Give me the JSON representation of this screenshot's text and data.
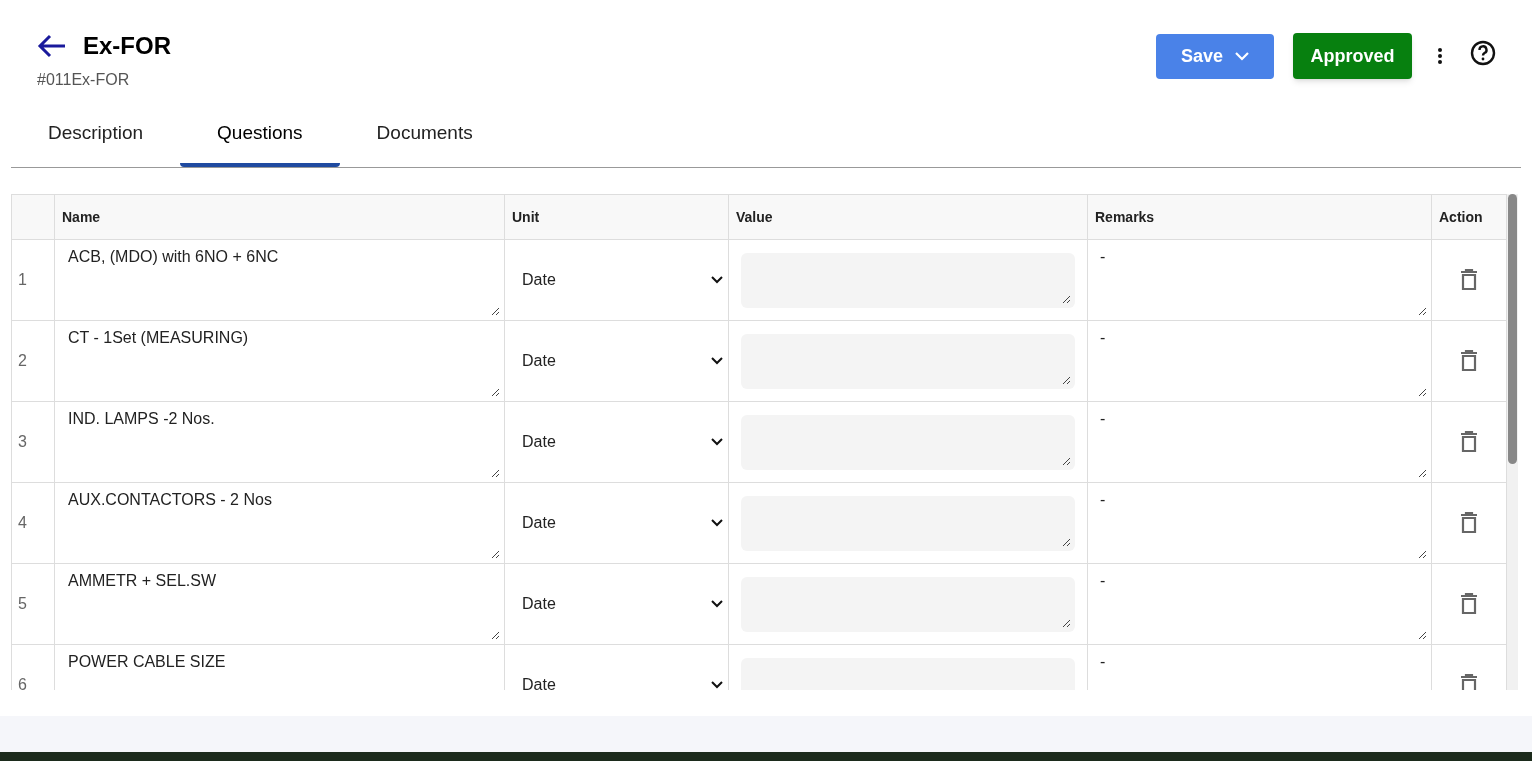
{
  "header": {
    "title": "Ex-FOR",
    "subtitle": "#011Ex-FOR",
    "save_button": "Save",
    "status_button": "Approved"
  },
  "tabs": [
    {
      "label": "Description",
      "selected": false
    },
    {
      "label": "Questions",
      "selected": true
    },
    {
      "label": "Documents",
      "selected": false
    }
  ],
  "table": {
    "columns": [
      "Name",
      "Unit",
      "Value",
      "Remarks",
      "Action"
    ],
    "rows": [
      {
        "index": "1",
        "name": "ACB, (MDO) with 6NO + 6NC",
        "unit": "Date",
        "remarks": "-"
      },
      {
        "index": "2",
        "name": "CT - 1Set (MEASURING)",
        "unit": "Date",
        "remarks": "-"
      },
      {
        "index": "3",
        "name": "IND. LAMPS -2 Nos.",
        "unit": "Date",
        "remarks": "-"
      },
      {
        "index": "4",
        "name": "AUX.CONTACTORS - 2 Nos",
        "unit": "Date",
        "remarks": "-"
      },
      {
        "index": "5",
        "name": "AMMETR + SEL.SW",
        "unit": "Date",
        "remarks": "-"
      },
      {
        "index": "6",
        "name": "POWER CABLE SIZE",
        "unit": "Date",
        "remarks": "-"
      }
    ]
  }
}
